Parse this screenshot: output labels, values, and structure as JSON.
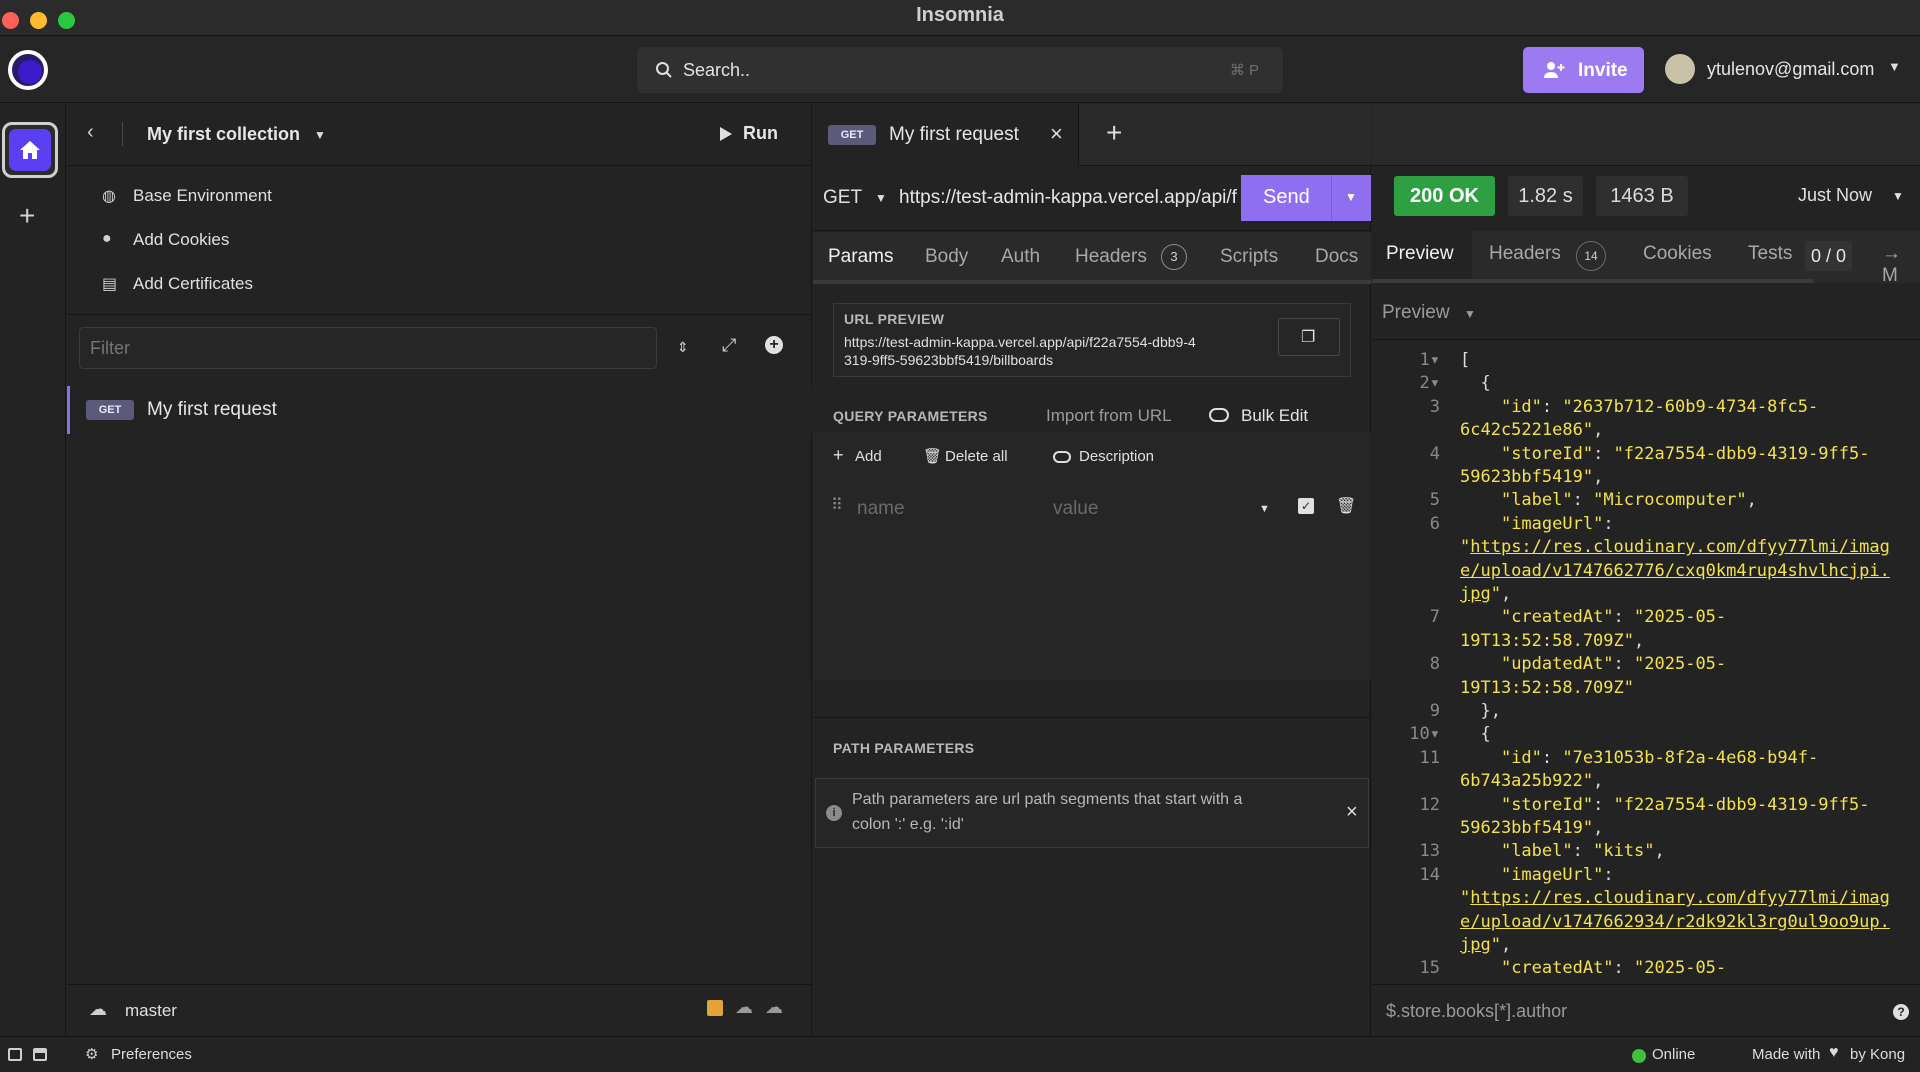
{
  "window": {
    "title": "Insomnia"
  },
  "topbar": {
    "search_placeholder": "Search..",
    "search_shortcut": "⌘ P",
    "invite_label": "Invite",
    "user_email": "ytulenov@gmail.com"
  },
  "sidebar": {
    "collection_name": "My first collection",
    "run_label": "Run",
    "items": [
      {
        "label": "Base Environment",
        "icon": "globe-icon"
      },
      {
        "label": "Add Cookies",
        "icon": "cookie-icon"
      },
      {
        "label": "Add Certificates",
        "icon": "certificate-icon"
      }
    ],
    "filter_placeholder": "Filter",
    "requests": [
      {
        "method": "GET",
        "name": "My first request"
      }
    ],
    "branch": "master"
  },
  "request": {
    "tab_method": "GET",
    "tab_name": "My first request",
    "method": "GET",
    "url": "https://test-admin-kappa.vercel.app/api/f22a7554-dbb9-4319-9ff5-59623bbf5419/billboards",
    "send_label": "Send",
    "tabs": [
      "Params",
      "Body",
      "Auth",
      "Headers",
      "Scripts",
      "Docs"
    ],
    "headers_count": "3",
    "url_preview_title": "URL PREVIEW",
    "url_preview_line1": "https://test-admin-kappa.vercel.app/api/f22a7554-dbb9-4",
    "url_preview_line2": "319-9ff5-59623bbf5419/billboards",
    "query_title": "QUERY PARAMETERS",
    "import_label": "Import from URL",
    "bulk_edit_label": "Bulk Edit",
    "add_label": "Add",
    "delete_all_label": "Delete all",
    "description_label": "Description",
    "name_placeholder": "name",
    "value_placeholder": "value",
    "path_title": "PATH PARAMETERS",
    "path_info_line1": "Path parameters are url path segments that start with a",
    "path_info_line2": "colon ':' e.g. ':id'"
  },
  "response": {
    "status": "200 OK",
    "status_color": "#2ea043",
    "time": "1.82 s",
    "size": "1463 B",
    "when": "Just Now",
    "tabs": [
      "Preview",
      "Headers",
      "Cookies",
      "Tests"
    ],
    "headers_count": "14",
    "tests_count": "0 / 0",
    "more_label": "→ M",
    "preview_mode": "Preview",
    "filter_placeholder": "$.store.books[*].author"
  },
  "footer": {
    "preferences_label": "Preferences",
    "online_label": "Online",
    "made_with_prefix": "Made with",
    "made_with_suffix": "by Kong"
  }
}
